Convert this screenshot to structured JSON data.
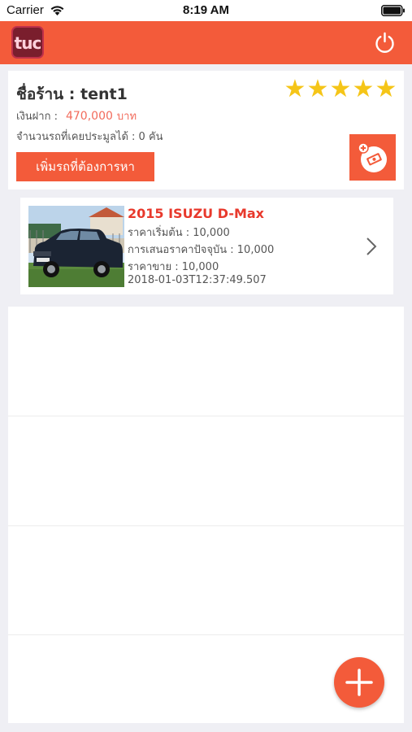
{
  "status_bar": {
    "carrier": "Carrier",
    "time": "8:19 AM"
  },
  "nav": {
    "logo_text": "tuc"
  },
  "shop": {
    "name": "ชื่อร้าน : tent1",
    "rating": 5,
    "deposit_label": "เงินฝาก :",
    "deposit_value": "470,000",
    "deposit_unit": "บาท",
    "auction_count": "จำนวนรถที่เคยประมูลได้ : 0 คัน",
    "add_car_label": "เพิ่มรถที่ต้องการหา"
  },
  "cars": [
    {
      "title": "2015 ISUZU D-Max",
      "start_price": "ราคาเริ่มต้น : 10,000",
      "current_offer": "การเสนอราคาปัจจุบัน : 10,000",
      "sale_price": "ราคาขาย : 10,000",
      "timestamp": "2018-01-03T12:37:49.507"
    }
  ],
  "colors": {
    "accent": "#f35b3a",
    "title_red": "#e8392c",
    "price_red": "#f26b5b",
    "star": "#f5c518"
  },
  "icons": [
    "wifi-icon",
    "battery-icon",
    "power-icon",
    "star-icon",
    "bid-icon",
    "chevron-right-icon",
    "plus-icon"
  ]
}
